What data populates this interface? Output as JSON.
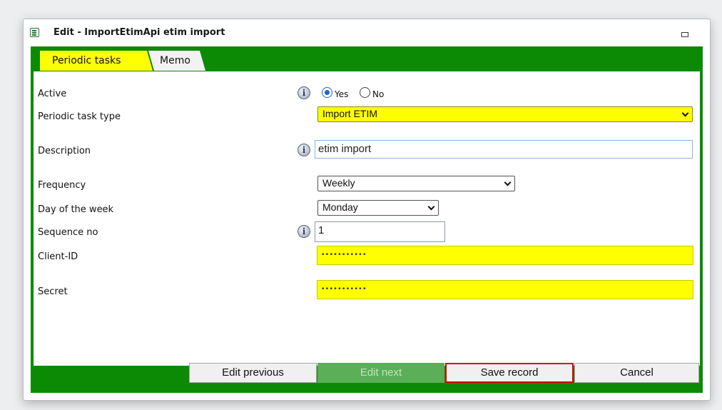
{
  "window": {
    "title": "Edit - ImportEtimApi etim import"
  },
  "tabs": {
    "periodic_tasks": "Periodic tasks",
    "memo": "Memo"
  },
  "form": {
    "active": {
      "label": "Active",
      "yes": "Yes",
      "no": "No",
      "selected": "Yes"
    },
    "task_type": {
      "label": "Periodic task type",
      "value": "Import ETIM"
    },
    "description": {
      "label": "Description",
      "value": "etim import"
    },
    "frequency": {
      "label": "Frequency",
      "value": "Weekly"
    },
    "day_of_week": {
      "label": "Day of the week",
      "value": "Monday"
    },
    "sequence": {
      "label": "Sequence no",
      "value": "1"
    },
    "client_id": {
      "label": "Client-ID",
      "value": "•••••••••••"
    },
    "secret": {
      "label": "Secret",
      "value": "•••••••••••"
    }
  },
  "buttons": {
    "edit_previous": "Edit previous",
    "edit_next": "Edit next",
    "save_record": "Save record",
    "cancel": "Cancel"
  },
  "icons": {
    "info": "i"
  },
  "colors": {
    "green": "#0c8a06",
    "highlight": "#ffff00",
    "save_outline": "#e00000"
  }
}
